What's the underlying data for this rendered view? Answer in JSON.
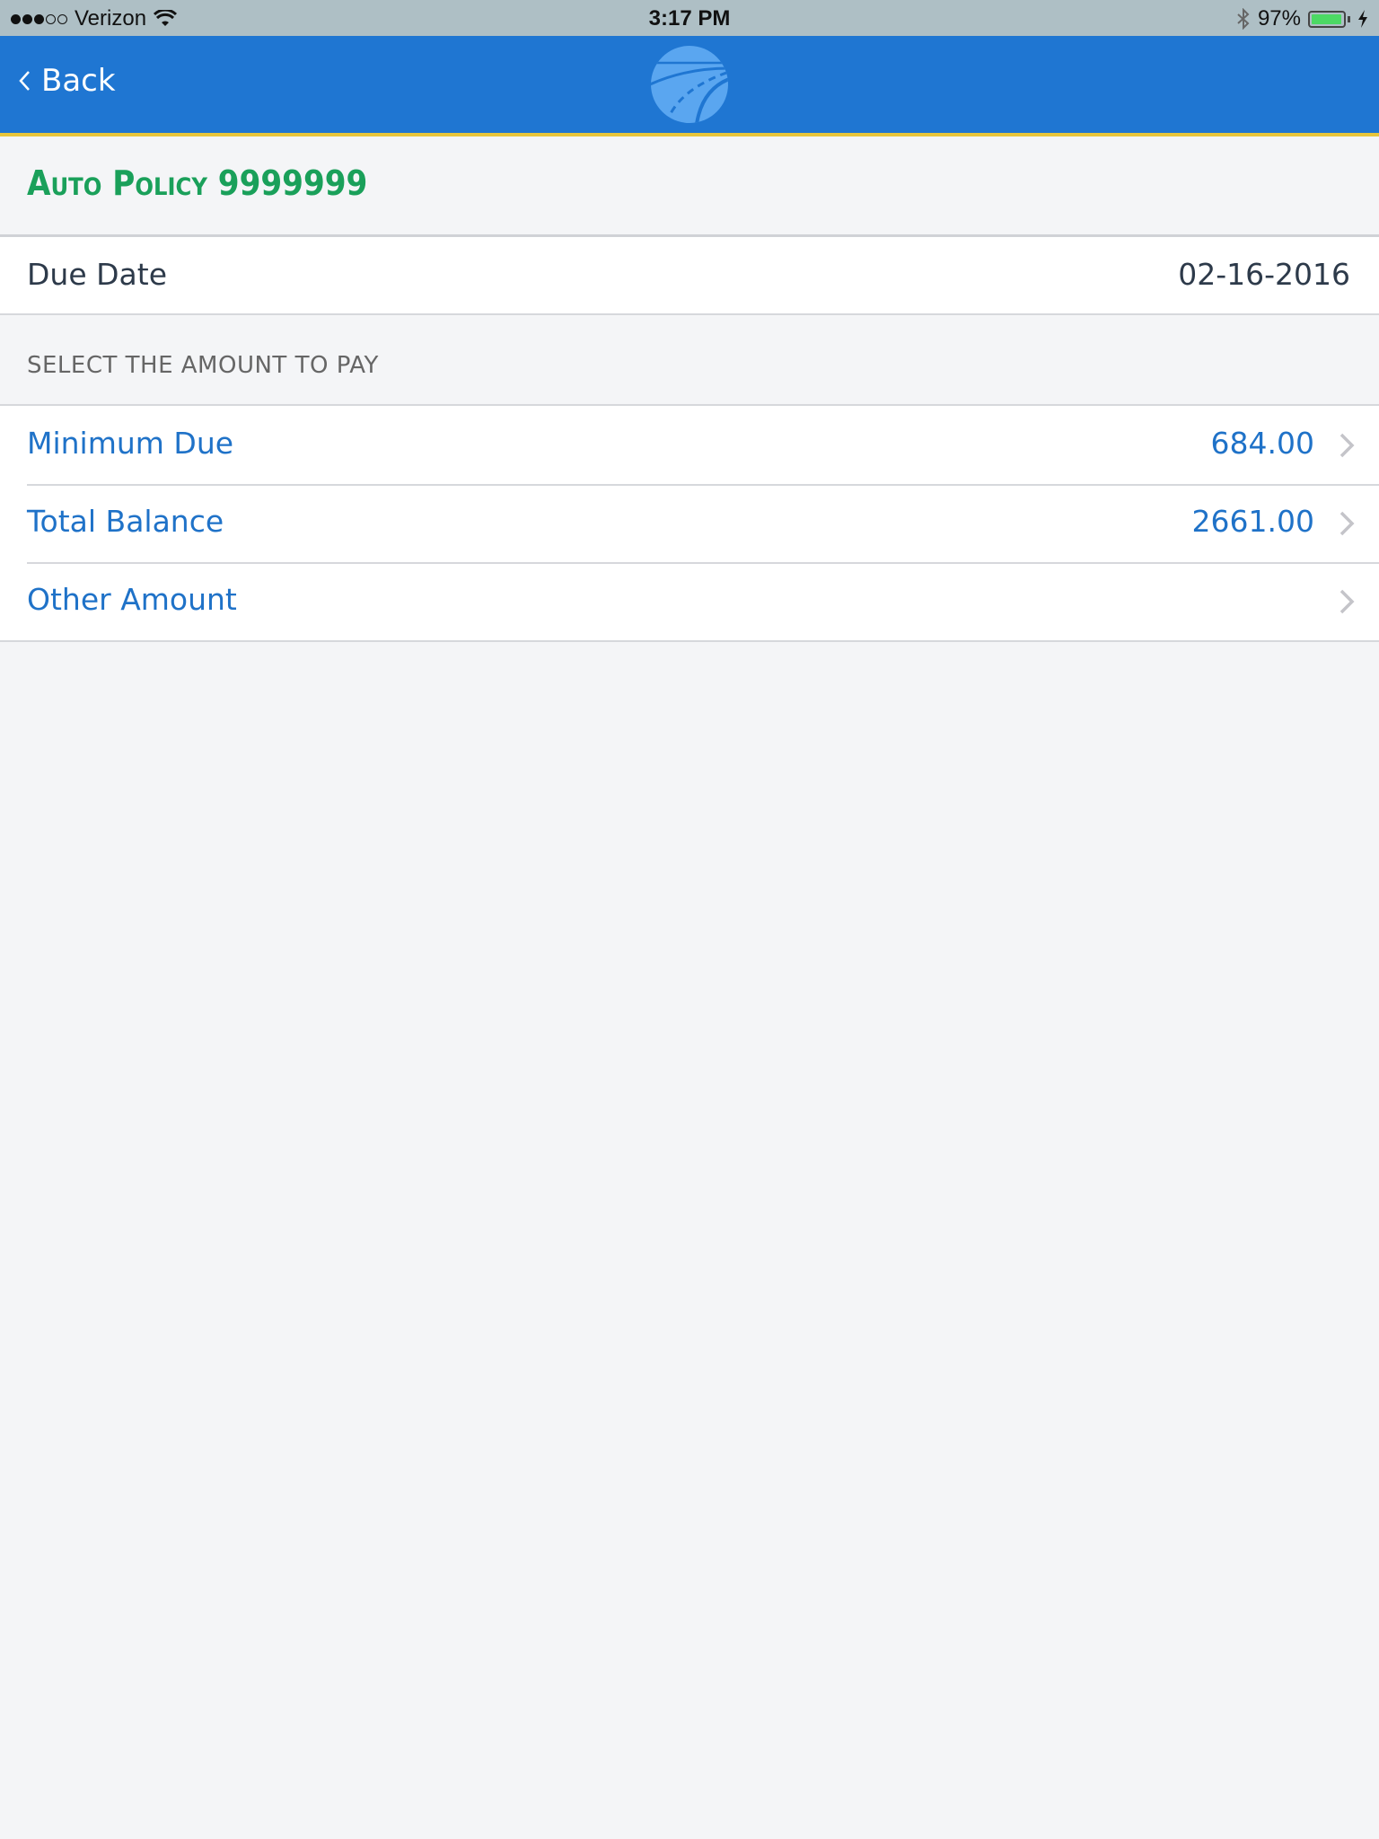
{
  "status_bar": {
    "carrier": "Verizon",
    "signal_bars_filled": 3,
    "signal_bars_total": 5,
    "time": "3:17 PM",
    "battery_percent": "97%",
    "battery_level": 0.97,
    "icons": [
      "signal-icon",
      "wifi-icon",
      "bluetooth-icon",
      "battery-icon",
      "charging-icon"
    ]
  },
  "nav": {
    "back_label": "Back",
    "logo_icon": "road-globe-logo"
  },
  "colors": {
    "nav_blue": "#1f76d2",
    "accent_yellow": "#e8c53a",
    "policy_green": "#1aa05a",
    "link_blue": "#1f72c8",
    "background": "#f4f5f7"
  },
  "policy": {
    "title": "Auto Policy 9999999"
  },
  "due_date": {
    "label": "Due Date",
    "value": "02-16-2016"
  },
  "section": {
    "header": "SELECT THE AMOUNT TO PAY"
  },
  "amount_options": [
    {
      "label": "Minimum Due",
      "value": "684.00"
    },
    {
      "label": "Total Balance",
      "value": "2661.00"
    },
    {
      "label": "Other Amount",
      "value": ""
    }
  ]
}
